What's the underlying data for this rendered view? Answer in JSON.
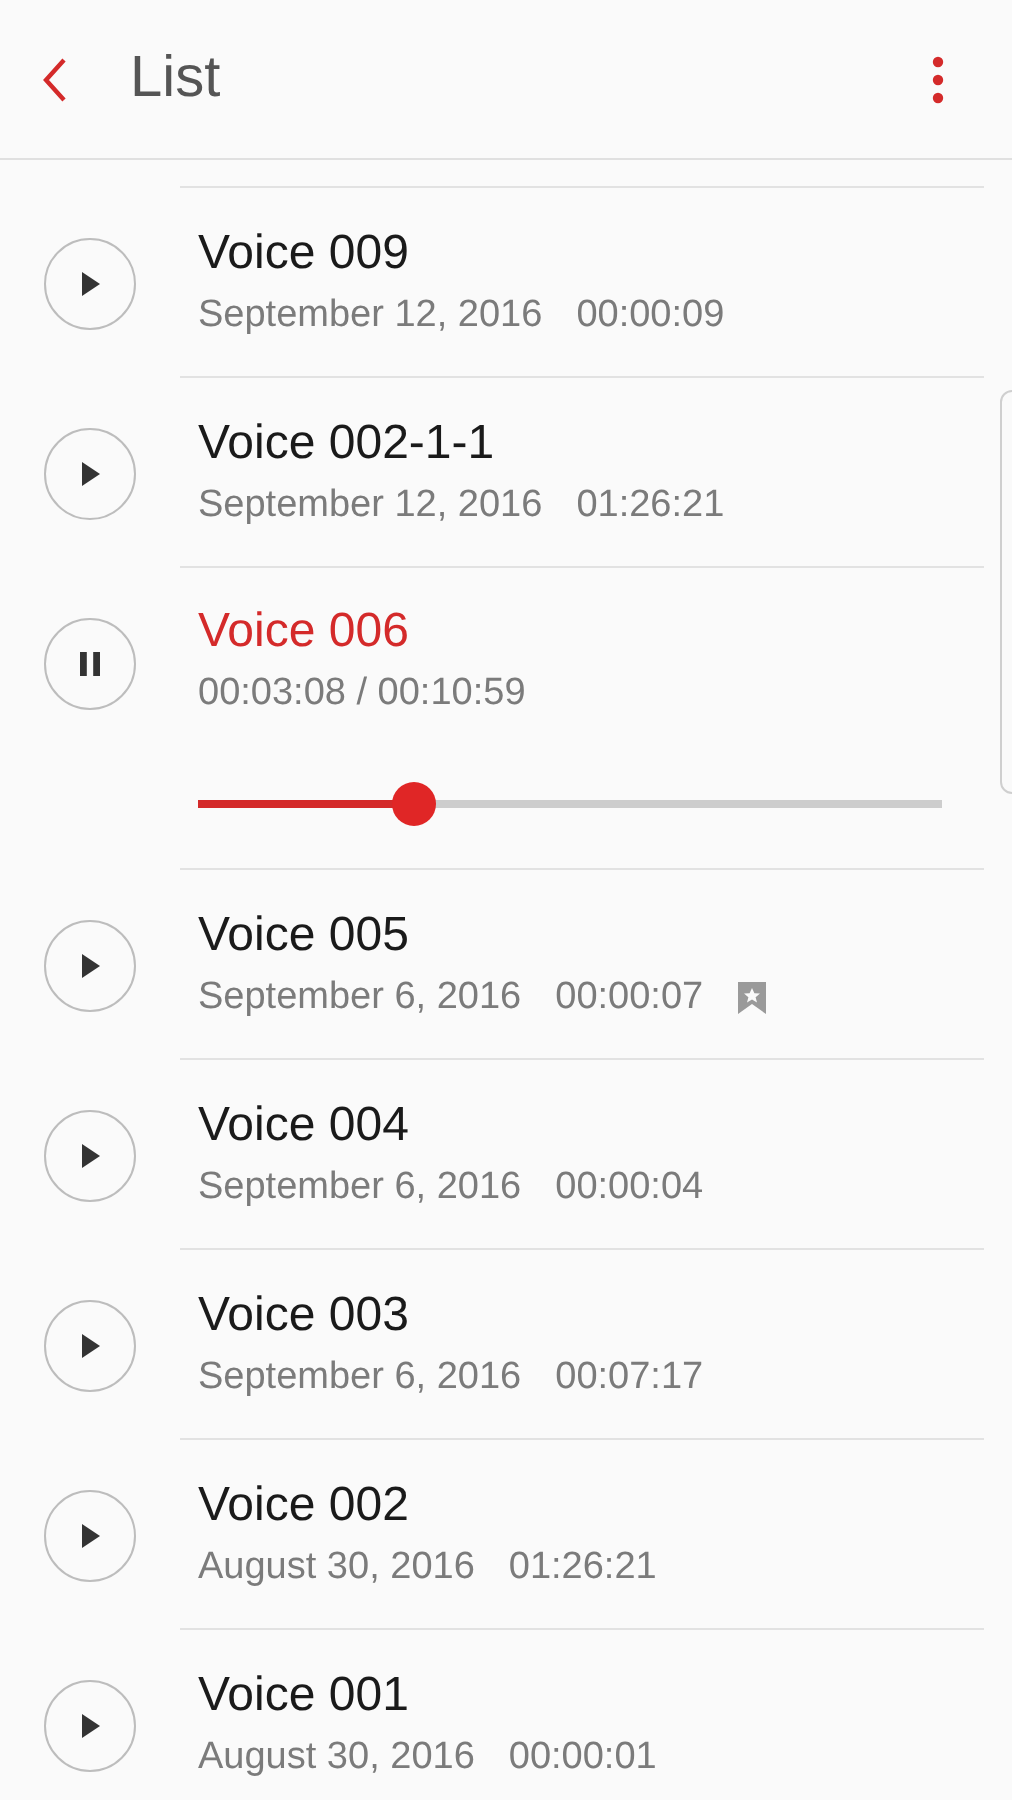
{
  "header": {
    "title": "List"
  },
  "recordings": [
    {
      "title": "Voice 009",
      "date": "September 12, 2016",
      "duration": "00:00:09",
      "bookmarked": false,
      "playing": false
    },
    {
      "title": "Voice 002-1-1",
      "date": "September 12, 2016",
      "duration": "01:26:21",
      "bookmarked": false,
      "playing": false
    },
    {
      "title": "Voice 006",
      "progress": "00:03:08 / 00:10:59",
      "level": 0.29,
      "playing": true
    },
    {
      "title": "Voice 005",
      "date": "September 6, 2016",
      "duration": "00:00:07",
      "bookmarked": true,
      "playing": false
    },
    {
      "title": "Voice 004",
      "date": "September 6, 2016",
      "duration": "00:00:04",
      "bookmarked": false,
      "playing": false
    },
    {
      "title": "Voice 003",
      "date": "September 6, 2016",
      "duration": "00:07:17",
      "bookmarked": false,
      "playing": false
    },
    {
      "title": "Voice 002",
      "date": "August 30, 2016",
      "duration": "01:26:21",
      "bookmarked": false,
      "playing": false
    },
    {
      "title": "Voice 001",
      "date": "August 30, 2016",
      "duration": "00:00:01",
      "bookmarked": false,
      "playing": false
    }
  ]
}
